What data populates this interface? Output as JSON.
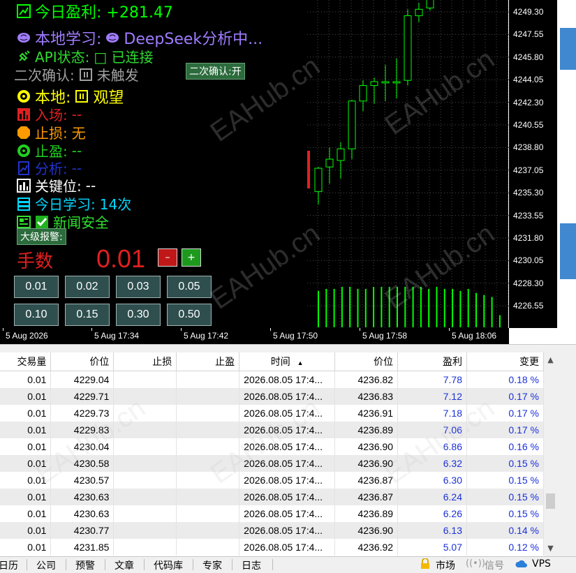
{
  "panel": {
    "profit": "今日盈利: +281.47",
    "local_learning_label": "本地学习:",
    "local_learning_value": "DeepSeek分析中...",
    "api_status_label": "API状态:",
    "api_status_value": "□ 已连接",
    "second_confirm_label": "二次确认:",
    "second_confirm_value": "未触发",
    "second_confirm_button": "二次确认:开",
    "local_signal_label": "本地:",
    "local_signal_value": "观望",
    "entry_label": "入场:",
    "entry_value": "--",
    "stoploss_label": "止损:",
    "stoploss_value": "无",
    "takeprofit_label": "止盈:",
    "takeprofit_value": "--",
    "analysis_label": "分析:",
    "analysis_value": "--",
    "keylevel_label": "关键位:",
    "keylevel_value": "--",
    "today_learning_label": "今日学习:",
    "today_learning_value": "14次",
    "news_label": "新闻安全",
    "big_alert_button": "大级报警:",
    "lots_label": "手数",
    "lots_value": "0.01",
    "minus_label": "–",
    "plus_label": "+",
    "lot_buttons": [
      "0.01",
      "0.02",
      "0.03",
      "0.05",
      "0.10",
      "0.15",
      "0.30",
      "0.50"
    ],
    "colors": {
      "profit": "#00ff00",
      "learning": "#9f7cff",
      "api": "#2fdc2f",
      "muted": "#a0a0a0",
      "local": "#ffff00",
      "entry": "#e02020",
      "stoploss": "#ff9b00",
      "takeprofit": "#20d020",
      "analysis": "#2233cc",
      "keylevel": "#ffffff",
      "today": "#00d8ff",
      "news": "#30e030",
      "lots": "#e02020"
    }
  },
  "chart": {
    "price_labels": [
      "4249.30",
      "4247.55",
      "4245.80",
      "4244.05",
      "4242.30",
      "4240.55",
      "4238.80",
      "4237.05",
      "4235.30",
      "4233.55",
      "4231.80",
      "4230.05",
      "4228.30",
      "4226.55"
    ],
    "time_labels": [
      "5 Aug 2026",
      "5 Aug 17:34",
      "5 Aug 17:42",
      "5 Aug 17:50",
      "5 Aug 17:58",
      "5 Aug 18:06"
    ],
    "candle_color": "#00ff00",
    "volume_color": "#00ff00",
    "candles": [
      {
        "o": 4235.4,
        "h": 4237.3,
        "l": 4234.4,
        "c": 4237.2
      },
      {
        "o": 4237.3,
        "h": 4238.8,
        "l": 4236.0,
        "c": 4237.9
      },
      {
        "o": 4237.8,
        "h": 4239.2,
        "l": 4236.4,
        "c": 4238.7
      },
      {
        "o": 4238.7,
        "h": 4242.5,
        "l": 4237.9,
        "c": 4242.4
      },
      {
        "o": 4242.4,
        "h": 4244.0,
        "l": 4241.6,
        "c": 4243.6
      },
      {
        "o": 4243.6,
        "h": 4244.2,
        "l": 4242.2,
        "c": 4243.9
      },
      {
        "o": 4243.8,
        "h": 4245.2,
        "l": 4242.4,
        "c": 4243.9
      },
      {
        "o": 4243.8,
        "h": 4245.7,
        "l": 4242.6,
        "c": 4243.9
      },
      {
        "o": 4244.0,
        "h": 4249.5,
        "l": 4243.6,
        "c": 4249.0
      },
      {
        "o": 4249.0,
        "h": 4250.0,
        "l": 4248.5,
        "c": 4249.5
      },
      {
        "o": 4249.6,
        "h": 4250.5,
        "l": 4249.4,
        "c": 4250.3
      }
    ],
    "volumes": [
      0.9,
      0.95,
      0.95,
      1.0,
      1.0,
      0.95,
      0.95,
      1.0,
      1.0,
      1.0,
      1.0,
      1.0,
      1.0,
      1.0,
      0.95,
      1.0,
      0.95,
      0.95,
      0.9,
      0.95,
      0.85,
      0.8,
      0.75,
      0.3
    ]
  },
  "table": {
    "headers": [
      "交易量",
      "价位",
      "止损",
      "止盈",
      "时间",
      "价位",
      "盈利",
      "变更"
    ],
    "sort_indicator": "▲",
    "rows": [
      [
        "0.01",
        "4229.04",
        "",
        "",
        "2026.08.05 17:4...",
        "4236.82",
        "7.78",
        "0.18 %"
      ],
      [
        "0.01",
        "4229.71",
        "",
        "",
        "2026.08.05 17:4...",
        "4236.83",
        "7.12",
        "0.17 %"
      ],
      [
        "0.01",
        "4229.73",
        "",
        "",
        "2026.08.05 17:4...",
        "4236.91",
        "7.18",
        "0.17 %"
      ],
      [
        "0.01",
        "4229.83",
        "",
        "",
        "2026.08.05 17:4...",
        "4236.89",
        "7.06",
        "0.17 %"
      ],
      [
        "0.01",
        "4230.04",
        "",
        "",
        "2026.08.05 17:4...",
        "4236.90",
        "6.86",
        "0.16 %"
      ],
      [
        "0.01",
        "4230.58",
        "",
        "",
        "2026.08.05 17:4...",
        "4236.90",
        "6.32",
        "0.15 %"
      ],
      [
        "0.01",
        "4230.57",
        "",
        "",
        "2026.08.05 17:4...",
        "4236.87",
        "6.30",
        "0.15 %"
      ],
      [
        "0.01",
        "4230.63",
        "",
        "",
        "2026.08.05 17:4...",
        "4236.87",
        "6.24",
        "0.15 %"
      ],
      [
        "0.01",
        "4230.63",
        "",
        "",
        "2026.08.05 17:4...",
        "4236.89",
        "6.26",
        "0.15 %"
      ],
      [
        "0.01",
        "4230.77",
        "",
        "",
        "2026.08.05 17:4...",
        "4236.90",
        "6.13",
        "0.14 %"
      ],
      [
        "0.01",
        "4231.85",
        "",
        "",
        "2026.08.05 17:4...",
        "4236.92",
        "5.07",
        "0.12 %"
      ]
    ]
  },
  "bottom_tabs": [
    "日历",
    "公司",
    "预警",
    "文章",
    "代码库",
    "专家",
    "日志"
  ],
  "status": {
    "market_label": "市场",
    "signal_label": "信号",
    "vps_label": "VPS"
  },
  "watermark": "EAHub.cn"
}
